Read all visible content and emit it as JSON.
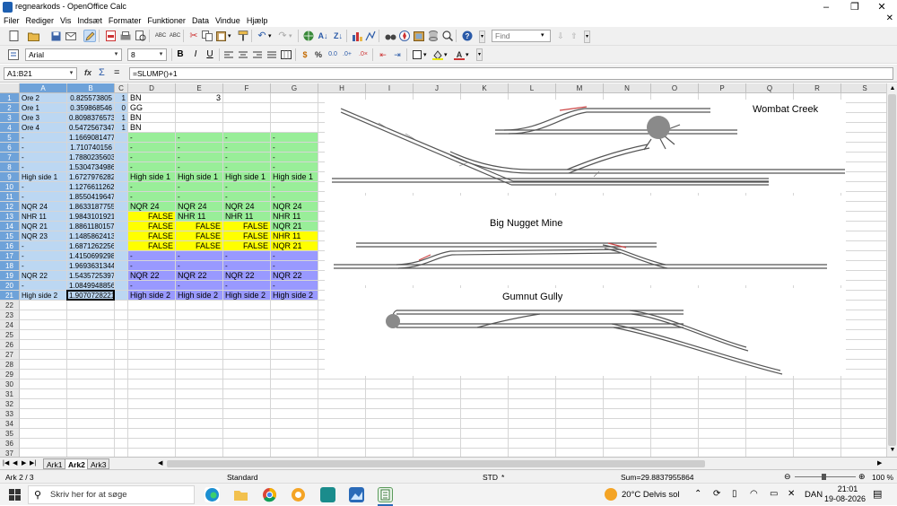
{
  "window": {
    "title": "regnearkods - OpenOffice Calc",
    "minimize": "–",
    "maximize": "❐",
    "close": "✕"
  },
  "menu": [
    "Filer",
    "Rediger",
    "Vis",
    "Indsæt",
    "Formater",
    "Funktioner",
    "Data",
    "Vindue",
    "Hjælp"
  ],
  "toolbar": {
    "find_placeholder": "Find",
    "font_name": "Arial",
    "font_size": "8",
    "bold": "B",
    "italic": "I",
    "underline": "U"
  },
  "formula": {
    "name_box": "A1:B21",
    "content": "=SLUMP()+1",
    "fx": "fx",
    "sum": "Σ",
    "equals": "="
  },
  "columns": [
    "A",
    "B",
    "C",
    "D",
    "E",
    "F",
    "G",
    "H",
    "I",
    "J",
    "K",
    "L",
    "M",
    "N",
    "O",
    "P",
    "Q",
    "R",
    "S"
  ],
  "rows": [
    "1",
    "2",
    "3",
    "4",
    "5",
    "6",
    "7",
    "8",
    "9",
    "10",
    "11",
    "12",
    "13",
    "14",
    "15",
    "16",
    "17",
    "18",
    "19",
    "20",
    "21",
    "22",
    "23",
    "24",
    "25",
    "26",
    "27",
    "28",
    "29",
    "30",
    "31",
    "32",
    "33",
    "34",
    "35",
    "36",
    "37"
  ],
  "cells": {
    "A": [
      "Ore 2",
      "Ore 1",
      "Ore 3",
      "Ore 4",
      "-",
      "-",
      "-",
      "-",
      "High side 1",
      "-",
      "-",
      "NQR 24",
      "NHR 11",
      "NQR 21",
      "NQR 23",
      "-",
      "-",
      "-",
      "NQR 22",
      "-",
      "High side 2"
    ],
    "B": [
      "0.825573805",
      "0.359868546",
      "0.8098376573",
      "0.5472567347",
      "1.1669081477",
      "1.710740156",
      "1.7880235603",
      "1.5304734986",
      "1.6727976282",
      "1.1276611262",
      "1.8550419647",
      "1.8633187755",
      "1.9843101921",
      "1.8861180157",
      "1.1485862413",
      "1.6871262256",
      "1.4150699298",
      "1.9693631344",
      "1.5435725397",
      "1.0849948856",
      "1.9070728221"
    ],
    "C": [
      "1",
      "0",
      "1",
      "1",
      "",
      "",
      "",
      "",
      "",
      "",
      "",
      "",
      "",
      "",
      "",
      "",
      "",
      "",
      "",
      "",
      ""
    ],
    "D": [
      "BN",
      "GG",
      "BN",
      "BN",
      "-",
      "-",
      "-",
      "-",
      "High side 1",
      "-",
      "-",
      "NQR 24",
      "FALSE",
      "FALSE",
      "FALSE",
      "FALSE",
      "-",
      "-",
      "NQR 22",
      "-",
      "High side 2"
    ],
    "E": [
      "3",
      "",
      "",
      "",
      "-",
      "-",
      "-",
      "-",
      "High side 1",
      "-",
      "-",
      "NQR 24",
      "NHR 11",
      "FALSE",
      "FALSE",
      "FALSE",
      "-",
      "-",
      "NQR 22",
      "-",
      "High side 2"
    ],
    "F": [
      "",
      "",
      "",
      "",
      "-",
      "-",
      "-",
      "-",
      "High side 1",
      "-",
      "-",
      "NQR 24",
      "NHR 11",
      "FALSE",
      "FALSE",
      "FALSE",
      "-",
      "-",
      "NQR 22",
      "-",
      "High side 2"
    ],
    "G": [
      "",
      "",
      "",
      "",
      "-",
      "-",
      "-",
      "-",
      "High side 1",
      "-",
      "-",
      "NQR 24",
      "NHR 11",
      "NQR 21",
      "NHR 11",
      "NQR 21",
      "-",
      "-",
      "NQR 22",
      "-",
      "High side 2"
    ]
  },
  "diagrams": {
    "wombat": "Wombat Creek",
    "nugget": "Big Nugget Mine",
    "gumnut": "Gumnut Gully"
  },
  "sheets": [
    "Ark1",
    "Ark2",
    "Ark3"
  ],
  "active_sheet": "Ark2",
  "status": {
    "sheet": "Ark 2 / 3",
    "style": "Standard",
    "mode": "STD",
    "star": "*",
    "sum": "Sum=29.8837955864",
    "zoom": "100 %"
  },
  "taskbar": {
    "search": "Skriv her for at søge",
    "weather": "20°C  Delvis sol",
    "lang": "DAN",
    "time": "21:01",
    "date": "19-08-2026"
  },
  "colors": {
    "selection": "#bcd7f2",
    "green": "#99ee99",
    "yellow": "#ffff00",
    "purple": "#9999ff",
    "header_selected": "#6ea2d9"
  }
}
